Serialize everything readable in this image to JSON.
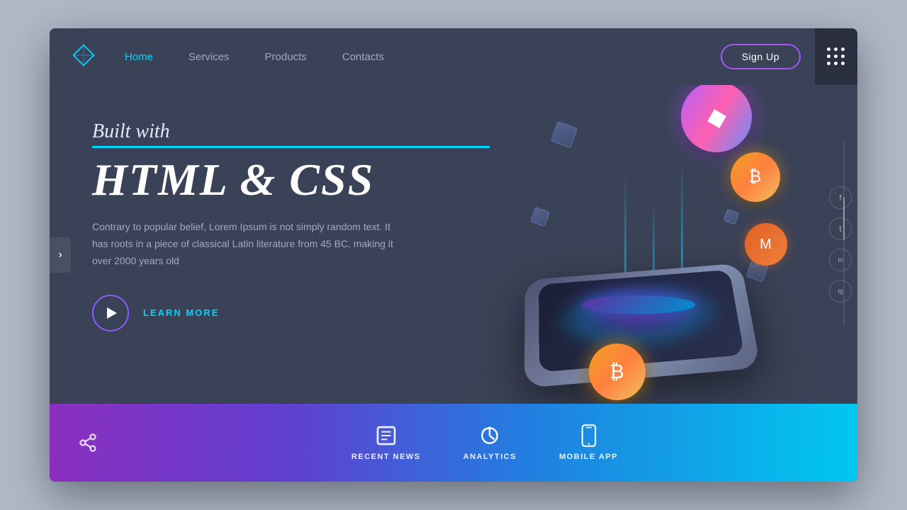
{
  "navbar": {
    "logo_label": "Diamond Logo",
    "links": [
      {
        "label": "Home",
        "active": true
      },
      {
        "label": "Services",
        "active": false
      },
      {
        "label": "Products",
        "active": false
      },
      {
        "label": "Contacts",
        "active": false
      }
    ],
    "signup_label": "Sign Up"
  },
  "hero": {
    "built_with": "Built with",
    "main_title": "HTML & CSS",
    "description": "Contrary to popular belief, Lorem Ipsum is not simply random text. It has roots in a piece of classical Latin literature from 45 BC, making it over 2000 years old",
    "cta_label": "LEARN MORE"
  },
  "bottom_bar": {
    "items": [
      {
        "label": "RECENT NEWS",
        "icon": "💬"
      },
      {
        "label": "ANALYTICS",
        "icon": "⚙️"
      },
      {
        "label": "MOBILE APP",
        "icon": "📱"
      }
    ]
  },
  "social": {
    "icons": [
      {
        "name": "facebook-icon",
        "char": "f"
      },
      {
        "name": "twitter-icon",
        "char": "t"
      },
      {
        "name": "linkedin-icon",
        "char": "in"
      },
      {
        "name": "instagram-icon",
        "char": "ig"
      }
    ]
  },
  "coins": {
    "eth_symbol": "◆",
    "btc_symbol": "₿",
    "monero_symbol": "M"
  }
}
